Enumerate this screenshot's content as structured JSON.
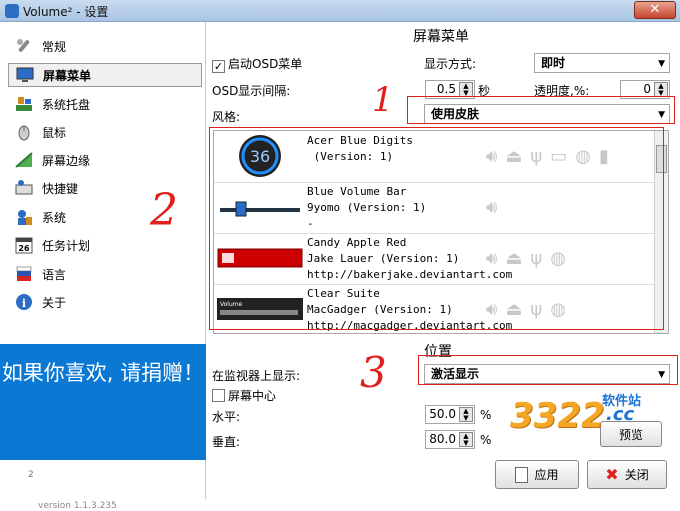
{
  "window": {
    "title": "Volume² - 设置",
    "close_glyph": "✕"
  },
  "sidebar": {
    "items": [
      {
        "label": "常规",
        "icon": "wrench-icon"
      },
      {
        "label": "屏幕菜单",
        "icon": "monitor-icon"
      },
      {
        "label": "系统托盘",
        "icon": "tray-icon"
      },
      {
        "label": "鼠标",
        "icon": "mouse-icon"
      },
      {
        "label": "屏幕边缘",
        "icon": "edge-icon"
      },
      {
        "label": "快捷键",
        "icon": "keyboard-icon"
      },
      {
        "label": "系统",
        "icon": "system-icon"
      },
      {
        "label": "任务计划",
        "icon": "calendar-icon"
      },
      {
        "label": "语言",
        "icon": "flag-icon"
      },
      {
        "label": "关于",
        "icon": "info-icon"
      }
    ],
    "selected_index": 1,
    "calendar_day": "26",
    "donate_text": "如果你喜欢, 请捐赠！",
    "logo_text": "2",
    "version": "version 1.1.3.235"
  },
  "osd": {
    "panel_title": "屏幕菜单",
    "enable_label": "启动OSD菜单",
    "enable_checked": true,
    "display_mode_label": "显示方式:",
    "display_mode_value": "即时",
    "interval_label": "OSD显示间隔:",
    "interval_value": "0.5",
    "interval_unit": "秒",
    "opacity_label": "透明度,%:",
    "opacity_value": "0",
    "style_label": "风格:",
    "style_value": "使用皮肤"
  },
  "skins": [
    {
      "name": "Acer Blue Digits",
      "line2": " (Version: 1)",
      "line3": "",
      "thumb_text": "36"
    },
    {
      "name": "Blue Volume Bar",
      "line2": "9yomo (Version: 1)",
      "line3": "-",
      "thumb_text": ""
    },
    {
      "name": "Candy Apple Red",
      "line2": "Jake Lauer (Version: 1)",
      "line3": "http://bakerjake.deviantart.com",
      "thumb_text": ""
    },
    {
      "name": "Clear Suite",
      "line2": "MacGadger (Version: 1)",
      "line3": "http://macgadger.deviantart.com",
      "thumb_text": "Volume"
    }
  ],
  "position": {
    "title": "位置",
    "monitor_label": "在监视器上显示:",
    "monitor_value": "激活显示",
    "center_label": "屏幕中心",
    "center_checked": false,
    "horizontal_label": "水平:",
    "horizontal_value": "50.0",
    "vertical_label": "垂直:",
    "vertical_value": "80.0",
    "percent": "%",
    "preview_label": "预览"
  },
  "buttons": {
    "apply": "应用",
    "close": "关闭"
  },
  "annotations": {
    "mark1": "1",
    "mark2": "2",
    "mark3": "3"
  },
  "watermark": {
    "digits": "3322",
    "suffix": ".cc",
    "site": "软件站"
  },
  "colors": {
    "accent": "#0b78d4",
    "annotation": "#e0201c",
    "close_button": "#c8452c"
  }
}
